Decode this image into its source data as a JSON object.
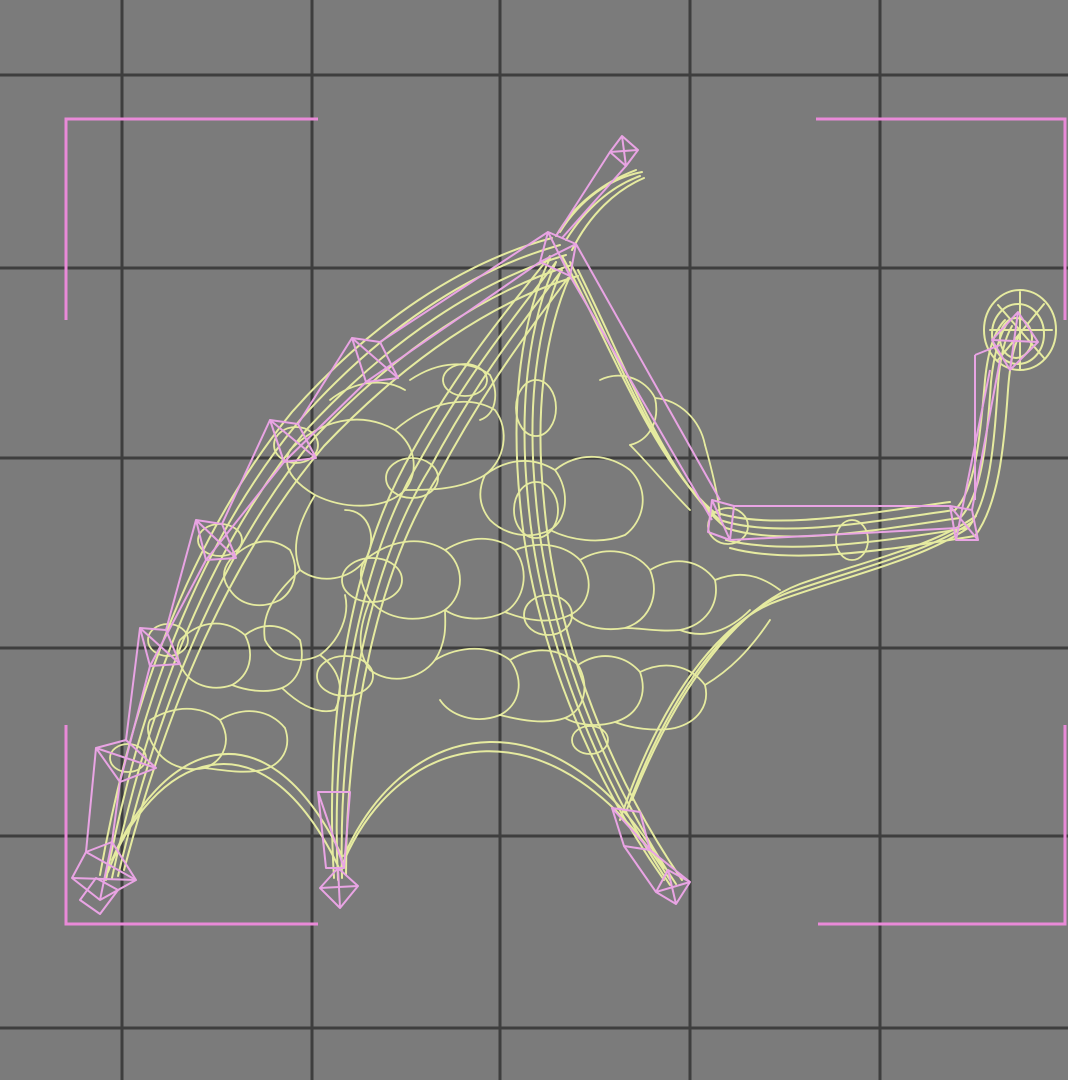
{
  "viewport": {
    "mode": "wireframe",
    "colors": {
      "background": "#7b7b7b",
      "grid": "#3e3e3e",
      "wireframe": "#e6eba0",
      "bones": "#e9a4e4",
      "safe_frame": "#e98ad8"
    },
    "grid": "on",
    "safe_frame": "on",
    "object": {
      "name": "",
      "type": "wing-membrane-mesh",
      "bones_visible": true
    }
  }
}
